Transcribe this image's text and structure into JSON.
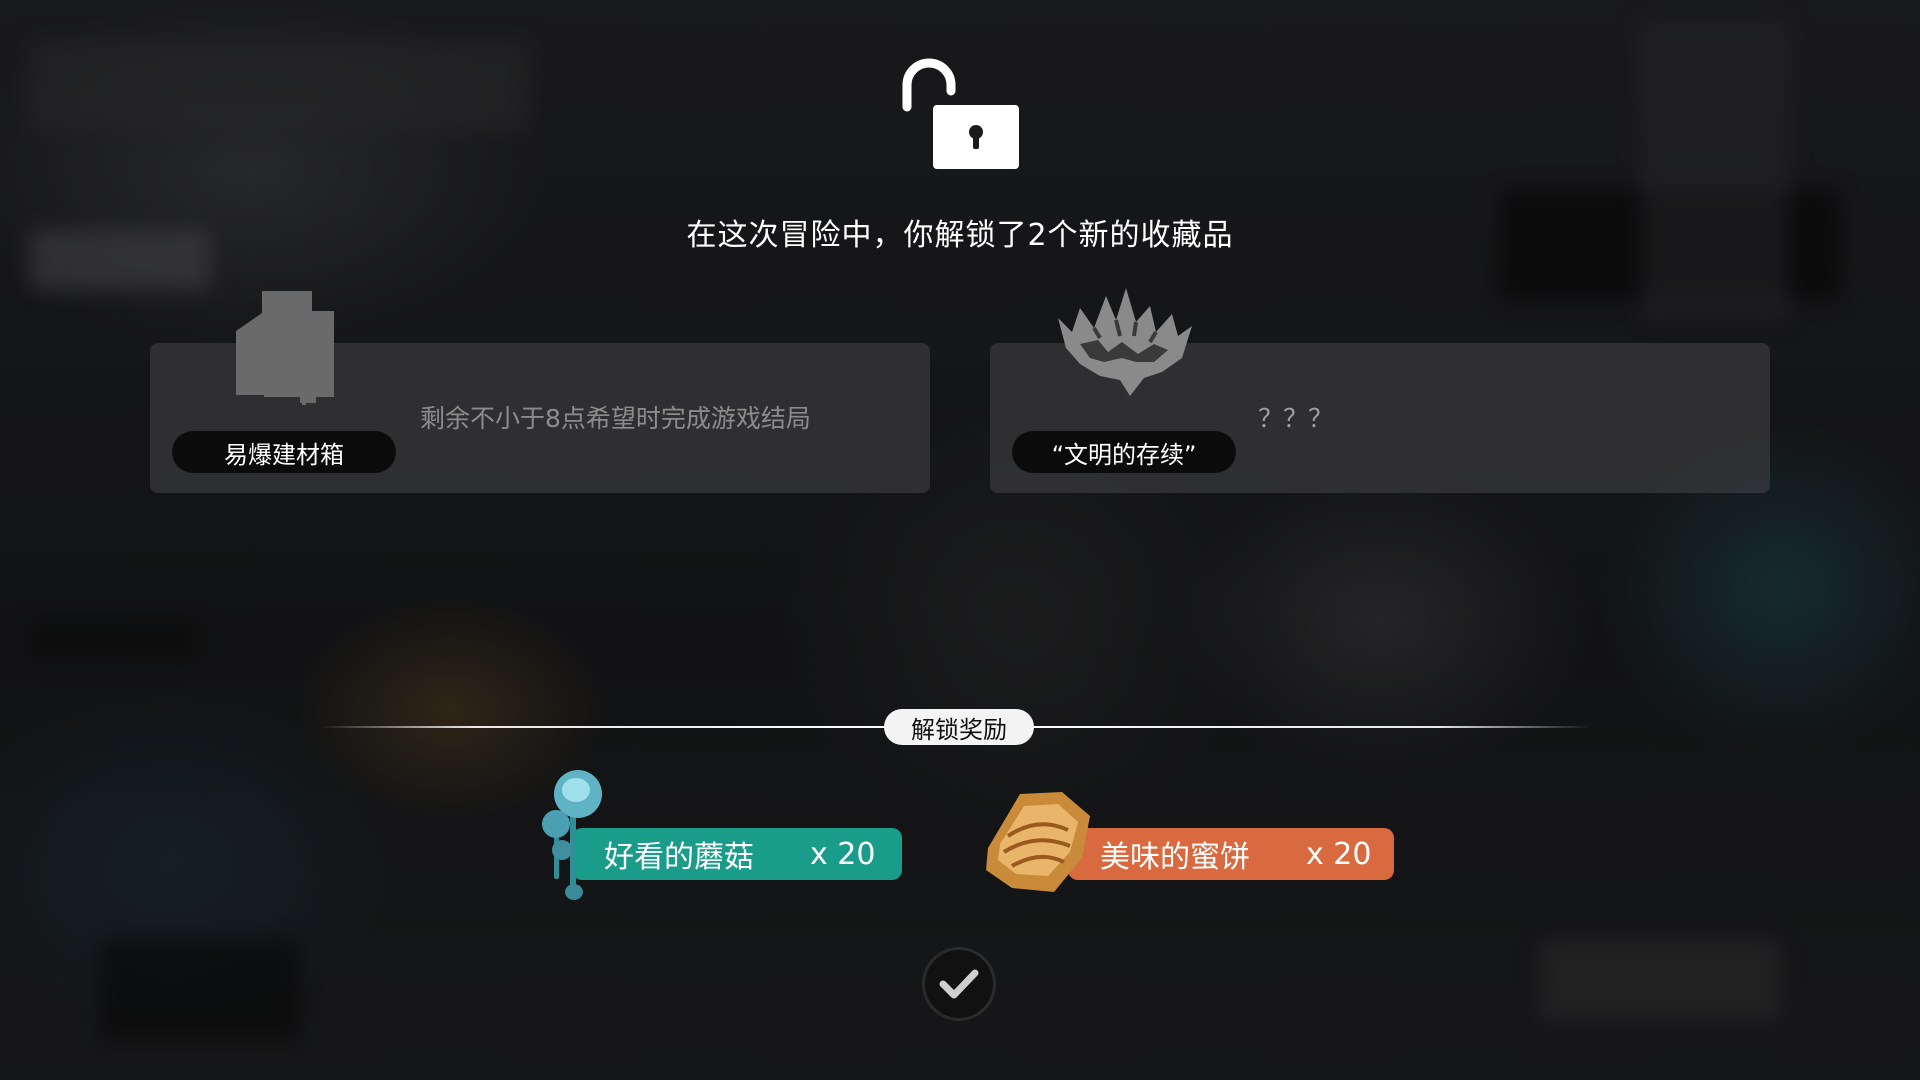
{
  "header": {
    "lock_icon": "unlocked-padlock-icon",
    "title": "在这次冒险中，你解锁了2个新的收藏品"
  },
  "collectibles": [
    {
      "name": "易爆建材箱",
      "description": "剩余不小于8点希望时完成游戏结局",
      "icon": "crate-icon"
    },
    {
      "name": "“文明的存续”",
      "description": "？？？",
      "icon": "crown-icon"
    }
  ],
  "rewards": {
    "label": "解锁奖励",
    "items": [
      {
        "name": "好看的蘑菇",
        "quantity": "x 20",
        "color": "#1a9c8a",
        "icon": "mushroom-icon"
      },
      {
        "name": "美味的蜜饼",
        "quantity": "x 20",
        "color": "#d9693f",
        "icon": "honey-cake-icon"
      }
    ]
  },
  "confirm": {
    "icon": "checkmark-icon"
  }
}
